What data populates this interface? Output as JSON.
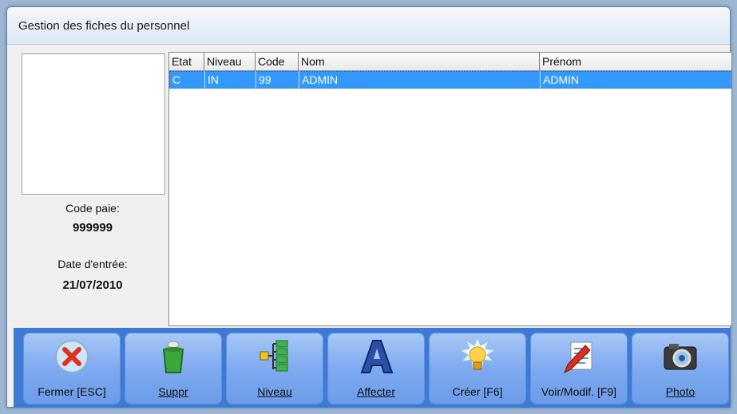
{
  "window": {
    "title": "Gestion des fiches du personnel"
  },
  "left_panel": {
    "code_paie_label": "Code paie:",
    "code_paie_value": "999999",
    "date_entree_label": "Date d'entrée:",
    "date_entree_value": "21/07/2010"
  },
  "grid": {
    "columns": [
      "Etat",
      "Niveau",
      "Code",
      "Nom",
      "Prénom"
    ],
    "rows": [
      [
        "C",
        "IN",
        "99",
        "ADMIN",
        "ADMIN"
      ]
    ]
  },
  "toolbar": {
    "buttons": [
      {
        "label": "Fermer [ESC]",
        "icon": "close-icon"
      },
      {
        "label": "Suppr",
        "icon": "trash-icon"
      },
      {
        "label": "Niveau",
        "icon": "hierarchy-icon"
      },
      {
        "label": "Affecter",
        "icon": "letter-a-icon"
      },
      {
        "label": "Créer [F6]",
        "icon": "lightbulb-icon"
      },
      {
        "label": "Voir/Modif. [F9]",
        "icon": "edit-document-icon"
      },
      {
        "label": "Photo",
        "icon": "camera-icon"
      }
    ]
  },
  "colors": {
    "selection": "#3399ff",
    "toolbar": "#3c7ad6"
  }
}
